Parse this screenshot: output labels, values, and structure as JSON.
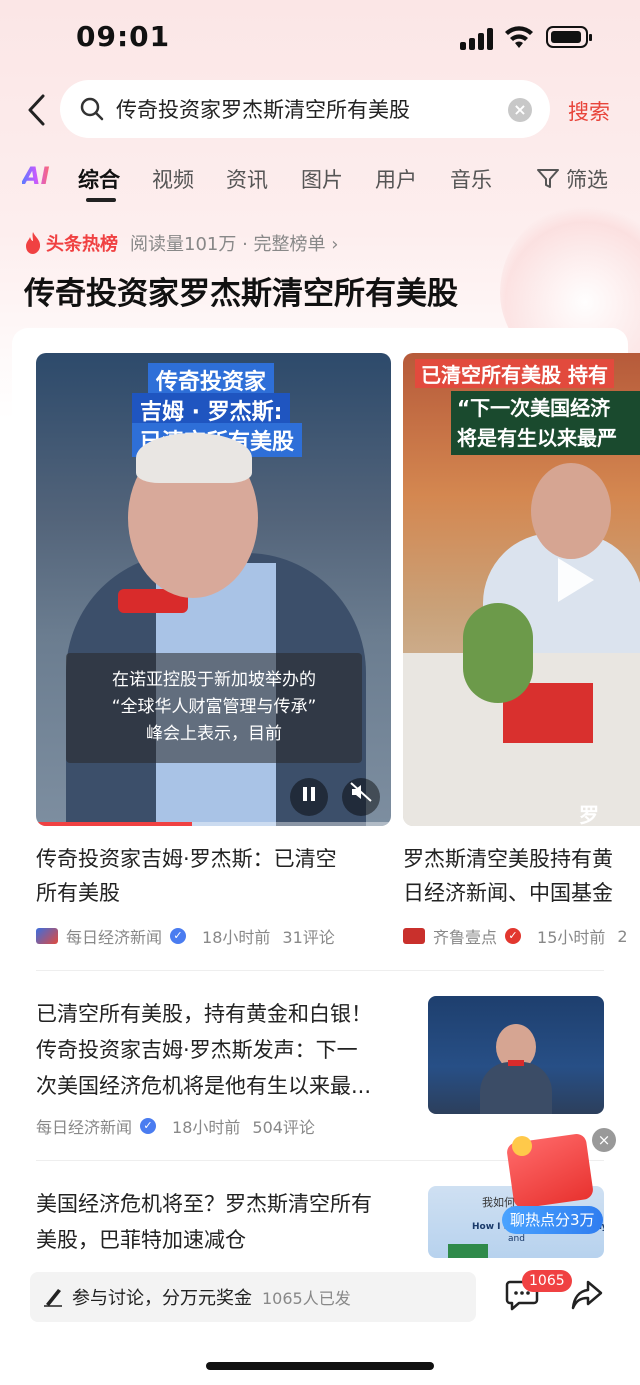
{
  "status_bar": {
    "time": "09:01"
  },
  "search": {
    "query": "传奇投资家罗杰斯清空所有美股",
    "action_label": "搜索"
  },
  "tabs": {
    "ai_label": "AI",
    "items": [
      "综合",
      "视频",
      "资讯",
      "图片",
      "用户",
      "音乐"
    ],
    "active": "综合",
    "filter_label": "筛选"
  },
  "hot": {
    "badge": "头条热榜",
    "meta": "阅读量101万 · 完整榜单 ›",
    "title": "传奇投资家罗杰斯清空所有美股"
  },
  "videos": [
    {
      "caption_lines": [
        "传奇投资家",
        "吉姆 · 罗杰斯:",
        "已清空所有美股"
      ],
      "subtitle_lines": [
        "在诺亚控股于新加坡举办的",
        "“全球华人财富管理与传承”",
        "峰会上表示，目前"
      ],
      "progress": 0.44,
      "title_lines": [
        "传奇投资家吉姆·罗杰斯：已清空",
        "所有美股"
      ],
      "source": "每日经济新闻",
      "time": "18小时前",
      "comments": "31评论"
    },
    {
      "caption_lines": [
        "已清空所有美股 持有",
        "“下一次美国经济",
        "将是有生以来最严"
      ],
      "watermark": "罗",
      "title_lines": [
        "罗杰斯清空美股持有黄",
        "日经济新闻、中国基金"
      ],
      "source": "齐鲁壹点",
      "time": "15小时前",
      "comments": "2"
    }
  ],
  "articles": [
    {
      "title_lines": [
        "已清空所有美股，持有黄金和白银！",
        "传奇投资家吉姆·罗杰斯发声：下一",
        "次美国经济危机将是他有生以来最..."
      ],
      "source": "每日经济新闻",
      "time": "18小时前",
      "comments": "504评论"
    },
    {
      "title_lines": [
        "美国经济危机将至？罗杰斯清空所有",
        "美股，巴菲特加速减仓"
      ],
      "thumb_text_lines": [
        "我如何",
        "How I See the World Today",
        "and"
      ]
    }
  ],
  "promo": {
    "label": "聊热点分3万"
  },
  "bottom_bar": {
    "prompt": "参与讨论，分万元奖金",
    "participants": "1065人已发",
    "comment_badge": "1065"
  },
  "colors": {
    "accent": "#f04142",
    "search_action": "#e8443a",
    "verified_blue": "#4a7cf0",
    "verified_red": "#e2372f"
  }
}
